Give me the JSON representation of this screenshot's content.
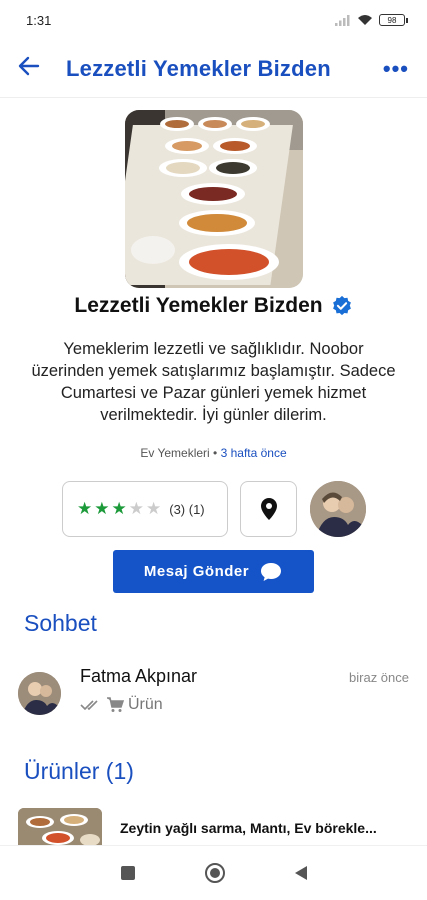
{
  "status_bar": {
    "time": "1:31",
    "battery": "98"
  },
  "app_bar": {
    "title": "Lezzetli Yemekler Bizden",
    "more_glyph": "•••"
  },
  "store": {
    "name": "Lezzetli Yemekler Bizden",
    "description": "Yemeklerim lezzetli ve sağlıklıdır. Noobor üzerinden yemek satışlarımız başlamıştır. Sadece Cumartesi ve Pazar günleri yemek hizmet verilmektedir. İyi günler dilerim.",
    "category": "Ev Yemekleri",
    "separator": " • ",
    "posted_ago": "3 hafta önce",
    "rating": 3,
    "rating_max": 5,
    "rating_counts": "(3) (1)",
    "verified_icon": "verified-badge-icon",
    "location_icon": "location-pin-icon"
  },
  "message_button": {
    "label": "Mesaj Gönder",
    "icon": "chat-bubble-icon"
  },
  "chat_section": {
    "title": "Sohbet",
    "items": [
      {
        "name": "Fatma Akpınar",
        "subtitle": "Ürün",
        "time": "biraz önce",
        "icons": [
          "double-check-icon",
          "cart-icon"
        ]
      }
    ]
  },
  "products_section": {
    "title": "Ürünler (1)",
    "items": [
      {
        "name": "Zeytin yağlı sarma, Mantı, Ev börekle..."
      }
    ]
  },
  "colors": {
    "primary": "#1a4fbf",
    "button": "#1454c8",
    "star": "#1c9a3a"
  }
}
